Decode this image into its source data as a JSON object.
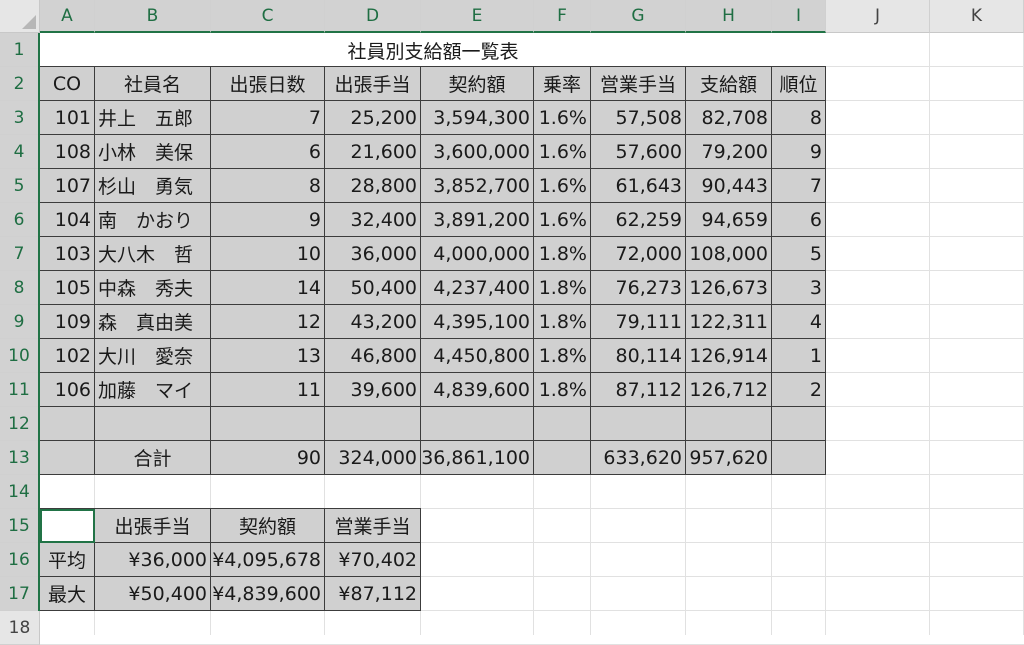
{
  "columns": [
    "A",
    "B",
    "C",
    "D",
    "E",
    "F",
    "G",
    "H",
    "I",
    "J",
    "K"
  ],
  "selected_columns": [
    "A",
    "B",
    "C",
    "D",
    "E",
    "F",
    "G",
    "H",
    "I"
  ],
  "rows": [
    "1",
    "2",
    "3",
    "4",
    "5",
    "6",
    "7",
    "8",
    "9",
    "10",
    "11",
    "12",
    "13",
    "14",
    "15",
    "16",
    "17",
    "18"
  ],
  "selected_rows": [
    "1",
    "2",
    "3",
    "4",
    "5",
    "6",
    "7",
    "8",
    "9",
    "10",
    "11",
    "12",
    "13",
    "14",
    "15",
    "16",
    "17"
  ],
  "title": "社員別支給額一覧表",
  "headers": [
    "CO",
    "社員名",
    "出張日数",
    "出張手当",
    "契約額",
    "乗率",
    "営業手当",
    "支給額",
    "順位"
  ],
  "employees": [
    [
      "101",
      "井上　五郎",
      "7",
      "25,200",
      "3,594,300",
      "1.6%",
      "57,508",
      "82,708",
      "8"
    ],
    [
      "108",
      "小林　美保",
      "6",
      "21,600",
      "3,600,000",
      "1.6%",
      "57,600",
      "79,200",
      "9"
    ],
    [
      "107",
      "杉山　勇気",
      "8",
      "28,800",
      "3,852,700",
      "1.6%",
      "61,643",
      "90,443",
      "7"
    ],
    [
      "104",
      "南　かおり",
      "9",
      "32,400",
      "3,891,200",
      "1.6%",
      "62,259",
      "94,659",
      "6"
    ],
    [
      "103",
      "大八木　哲",
      "10",
      "36,000",
      "4,000,000",
      "1.8%",
      "72,000",
      "108,000",
      "5"
    ],
    [
      "105",
      "中森　秀夫",
      "14",
      "50,400",
      "4,237,400",
      "1.8%",
      "76,273",
      "126,673",
      "3"
    ],
    [
      "109",
      "森　真由美",
      "12",
      "43,200",
      "4,395,100",
      "1.8%",
      "79,111",
      "122,311",
      "4"
    ],
    [
      "102",
      "大川　愛奈",
      "13",
      "46,800",
      "4,450,800",
      "1.8%",
      "80,114",
      "126,914",
      "1"
    ],
    [
      "106",
      "加藤　マイ",
      "11",
      "39,600",
      "4,839,600",
      "1.8%",
      "87,112",
      "126,712",
      "2"
    ]
  ],
  "total": {
    "label": "合計",
    "days": "90",
    "travel_allowance": "324,000",
    "contract": "36,861,100",
    "sales_allowance": "633,620",
    "payment": "957,620"
  },
  "summary": {
    "headers": [
      "出張手当",
      "契約額",
      "営業手当"
    ],
    "rows": [
      {
        "label": "平均",
        "values": [
          "¥36,000",
          "¥4,095,678",
          "¥70,402"
        ]
      },
      {
        "label": "最大",
        "values": [
          "¥50,400",
          "¥4,839,600",
          "¥87,112"
        ]
      }
    ]
  },
  "colors": {
    "header_bg": "#e6e6e6",
    "selected_header_bg": "#d2d2d2",
    "accent": "#217346",
    "cell_fill": "#d0d0d0",
    "border": "#3c3c3c",
    "gridline": "#e1e1e1"
  }
}
